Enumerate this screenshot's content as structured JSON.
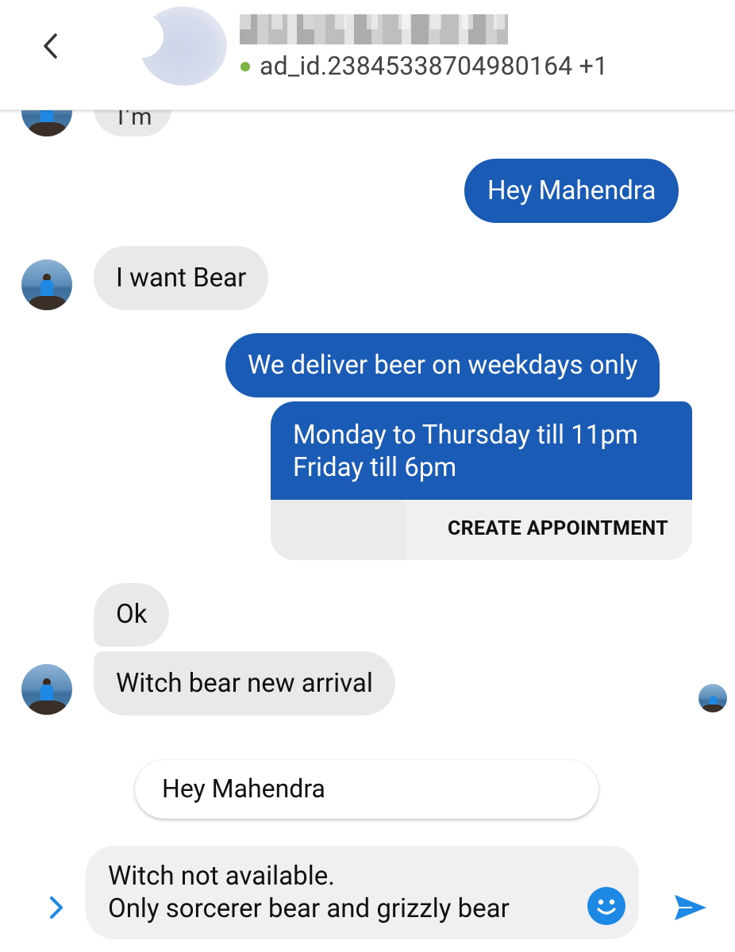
{
  "header": {
    "subtitle": "ad_id.23845338704980164 +1",
    "status_color": "#7cb342"
  },
  "messages": {
    "partial_fragment": "I'm",
    "m1": "Hey Mahendra",
    "m2": "I  want Bear",
    "m3": "We deliver beer on weekdays only",
    "card_line1": "Monday to Thursday till 11pm",
    "card_line2": "Friday till 6pm",
    "card_button": "CREATE APPOINTMENT",
    "m4": "Ok",
    "m5": "Witch bear new arrival"
  },
  "suggestion": {
    "text": "Hey Mahendra"
  },
  "composer": {
    "line1": "Witch not available.",
    "line2": "Only sorcerer bear and grizzly bear"
  },
  "icons": {
    "back": "chevron-left-icon",
    "expand": "chevron-right-icon",
    "emoji": "smiley-icon",
    "send": "send-icon"
  },
  "colors": {
    "outgoing_bubble": "#1a5cb5",
    "incoming_bubble": "#e9e9eb",
    "accent": "#1e88e5"
  }
}
